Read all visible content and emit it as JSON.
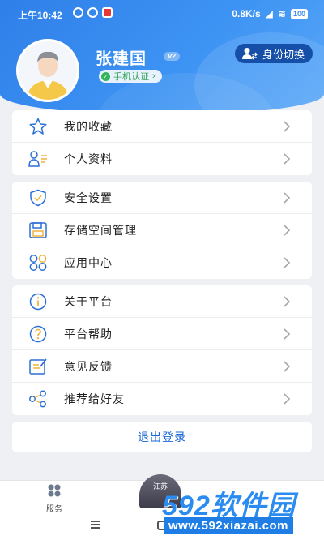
{
  "status_bar": {
    "time": "上午10:42",
    "network_speed": "0.8K/s",
    "battery": "100"
  },
  "profile": {
    "name": "张建国",
    "level_badge": "V2",
    "verify_label": "手机认证",
    "switch_label": "身份切换"
  },
  "menu_groups": [
    [
      {
        "label": "我的收藏",
        "icon": "star-icon"
      },
      {
        "label": "个人资料",
        "icon": "profile-icon"
      }
    ],
    [
      {
        "label": "安全设置",
        "icon": "shield-icon"
      },
      {
        "label": "存储空间管理",
        "icon": "storage-icon"
      },
      {
        "label": "应用中心",
        "icon": "apps-icon"
      }
    ],
    [
      {
        "label": "关于平台",
        "icon": "info-icon"
      },
      {
        "label": "平台帮助",
        "icon": "help-icon"
      },
      {
        "label": "意见反馈",
        "icon": "feedback-icon"
      },
      {
        "label": "推荐给好友",
        "icon": "share-icon"
      }
    ]
  ],
  "logout_label": "退出登录",
  "bottom_nav": {
    "service_label": "服务",
    "center_label": "江苏"
  },
  "watermark": {
    "brand": "592软件园",
    "url": "www.592xiazai.com"
  },
  "colors": {
    "primary": "#2f7fe8",
    "icon_blue": "#2b6fd6",
    "verify_green": "#34b45a"
  }
}
